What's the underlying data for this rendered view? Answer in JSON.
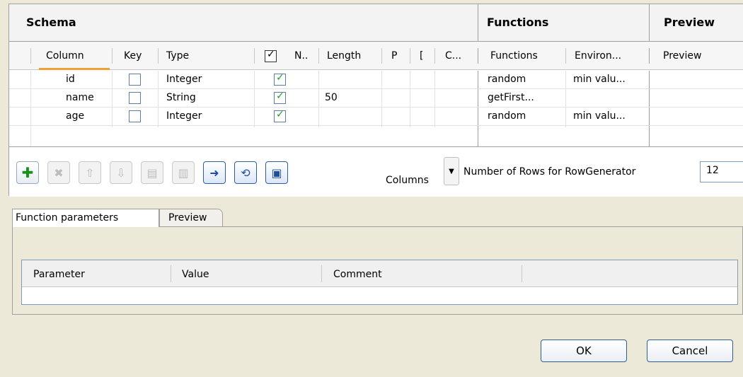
{
  "sections": {
    "schema": "Schema",
    "functions": "Functions",
    "preview": "Preview"
  },
  "columns": {
    "column": "Column",
    "key": "Key",
    "type": "Type",
    "nullable": "N..",
    "length": "Length",
    "precision": "P",
    "default": "[",
    "comment": "C...",
    "functions": "Functions",
    "environment": "Environ...",
    "preview": "Preview"
  },
  "rows": [
    {
      "column": "id",
      "key": false,
      "type": "Integer",
      "nullable": true,
      "length": "",
      "function": "random",
      "environment": "min valu..."
    },
    {
      "column": "name",
      "key": false,
      "type": "String",
      "nullable": true,
      "length": "50",
      "function": "getFirst...",
      "environment": ""
    },
    {
      "column": "age",
      "key": false,
      "type": "Integer",
      "nullable": true,
      "length": "",
      "function": "random",
      "environment": "min valu..."
    }
  ],
  "toolbar": {
    "columns_label": "Columns",
    "rows_label": "Number of Rows for RowGenerator",
    "rows_value": "12"
  },
  "tabs": {
    "function_parameters": "Function parameters",
    "preview": "Preview"
  },
  "params_table": {
    "parameter": "Parameter",
    "value": "Value",
    "comment": "Comment"
  },
  "buttons": {
    "ok": "OK",
    "cancel": "Cancel"
  },
  "colors": {
    "accent_green": "#21a121",
    "sort_orange": "#f0a030",
    "button_blue": "#2f5d9c"
  }
}
